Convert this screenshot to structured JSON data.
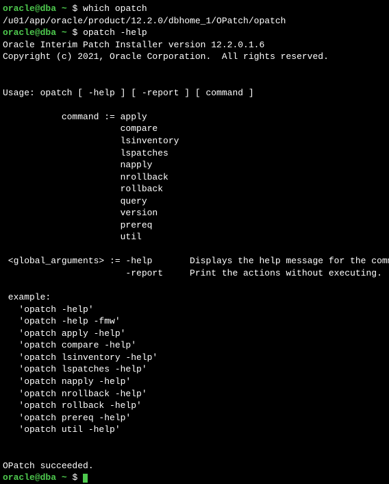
{
  "prompt": {
    "user": "oracle",
    "sep": "@",
    "host": "dba",
    "path": "~",
    "end": " $ "
  },
  "cmd1": "which opatch",
  "out1": "/u01/app/oracle/product/12.2.0/dbhome_1/OPatch/opatch",
  "cmd2": "opatch -help",
  "out2": "Oracle Interim Patch Installer version 12.2.0.1.6",
  "out3": "Copyright (c) 2021, Oracle Corporation.  All rights reserved.",
  "out4": "Usage: opatch [ -help ] [ -report ] [ command ]",
  "out5": "           command := apply",
  "out6": "                      compare",
  "out7": "                      lsinventory",
  "out8": "                      lspatches",
  "out9": "                      napply",
  "out10": "                      nrollback",
  "out11": "                      rollback",
  "out12": "                      query",
  "out13": "                      version",
  "out14": "                      prereq",
  "out15": "                      util",
  "out16": " <global_arguments> := -help       Displays the help message for the command.",
  "out17": "                       -report     Print the actions without executing.",
  "out18": " example:",
  "out19": "   'opatch -help'",
  "out20": "   'opatch -help -fmw'",
  "out21": "   'opatch apply -help'",
  "out22": "   'opatch compare -help'",
  "out23": "   'opatch lsinventory -help'",
  "out24": "   'opatch lspatches -help'",
  "out25": "   'opatch napply -help'",
  "out26": "   'opatch nrollback -help'",
  "out27": "   'opatch rollback -help'",
  "out28": "   'opatch prereq -help'",
  "out29": "   'opatch util -help'",
  "out30": "OPatch succeeded."
}
